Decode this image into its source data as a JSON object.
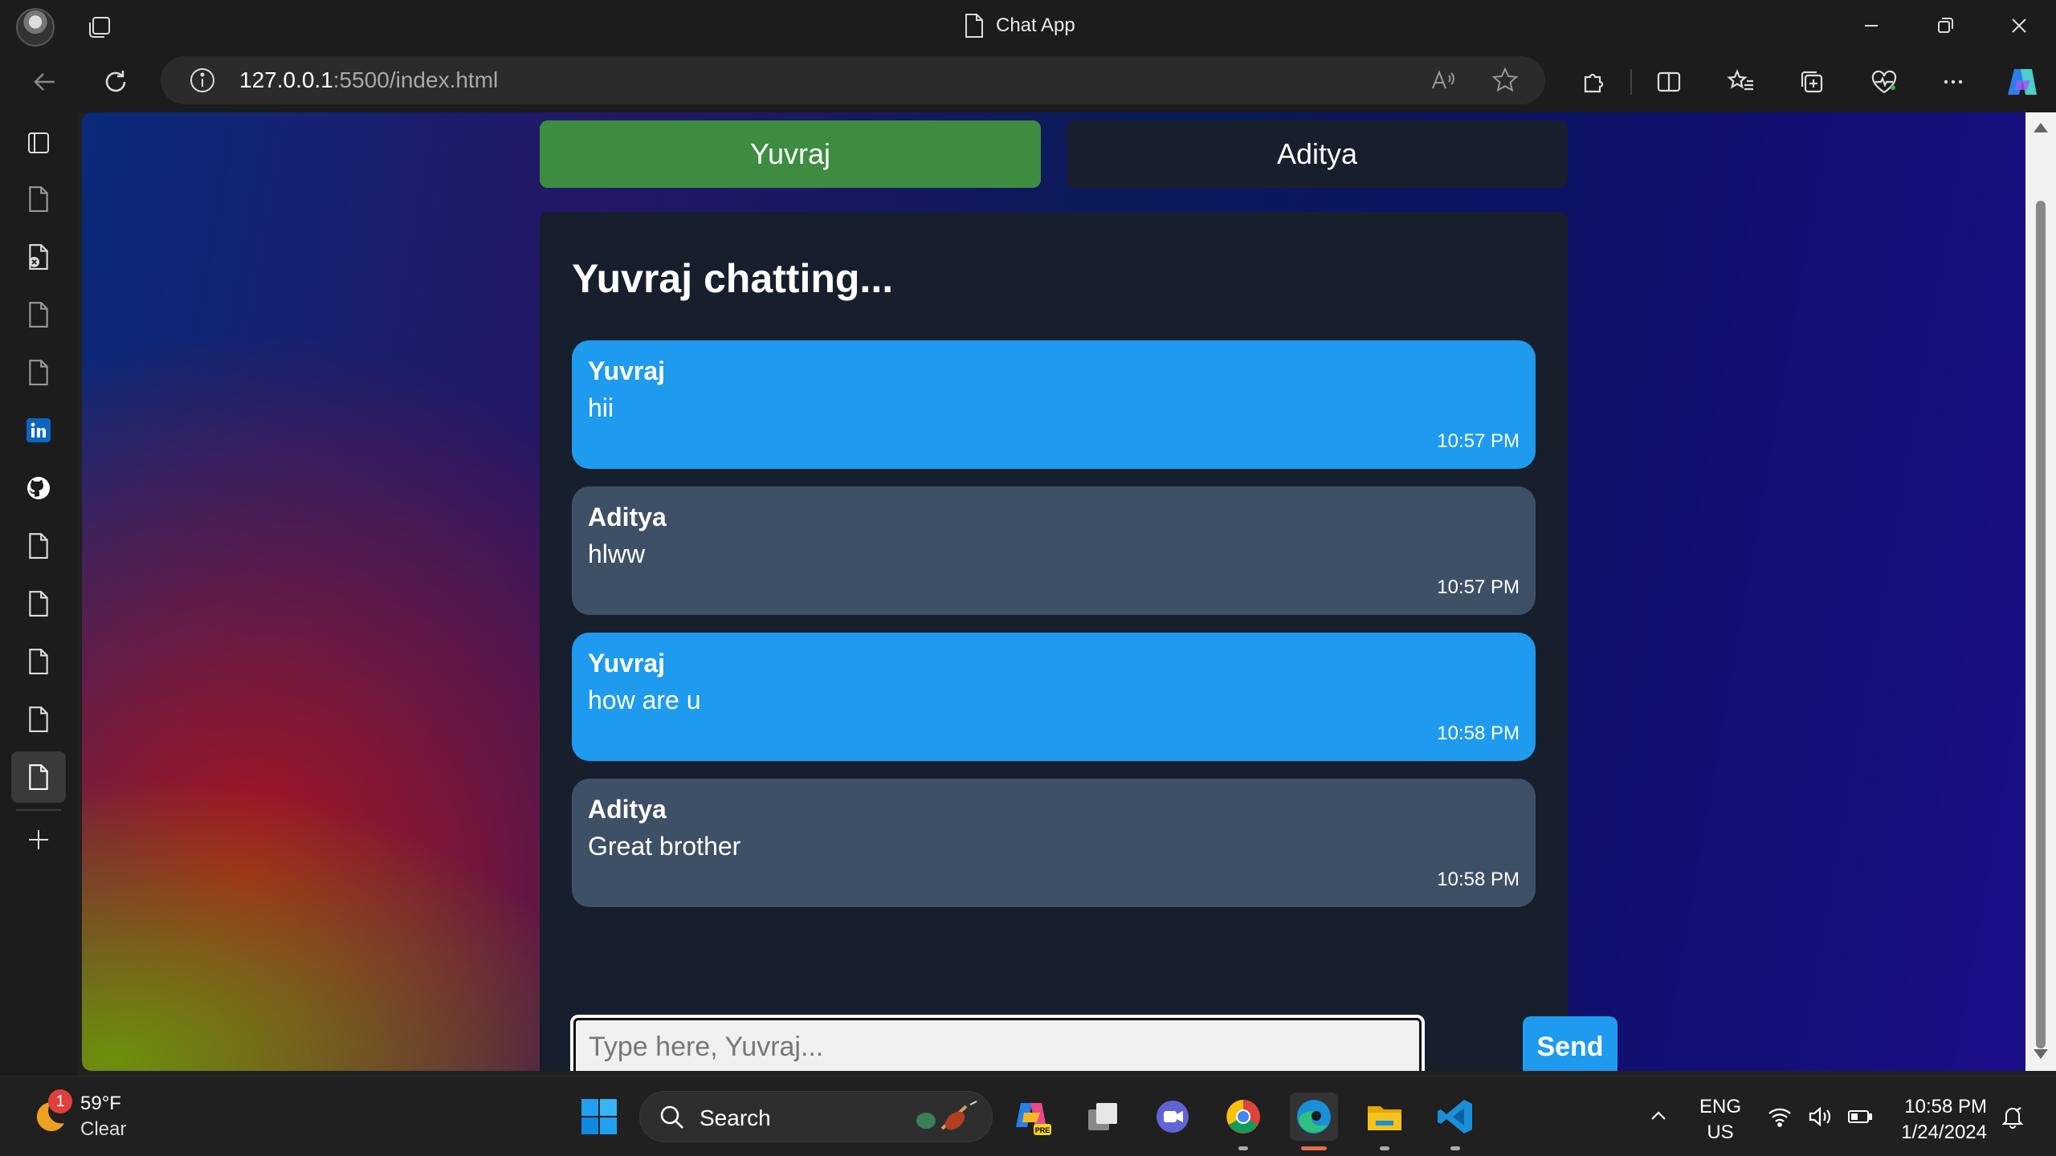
{
  "browser": {
    "tab_title": "Chat App",
    "url_host": "127.0.0.1",
    "url_rest": ":5500/index.html"
  },
  "app": {
    "tabs": [
      {
        "label": "Yuvraj",
        "color": "#3d8c40"
      },
      {
        "label": "Aditya",
        "color": "#171f2c"
      }
    ],
    "heading": "Yuvraj chatting...",
    "messages": [
      {
        "sender": "Yuvraj",
        "text": "hii",
        "time": "10:57 PM",
        "color": "#1e9bee"
      },
      {
        "sender": "Aditya",
        "text": "hlww",
        "time": "10:57 PM",
        "color": "#3e5066"
      },
      {
        "sender": "Yuvraj",
        "text": "how are u",
        "time": "10:58 PM",
        "color": "#1e9bee"
      },
      {
        "sender": "Aditya",
        "text": "Great brother",
        "time": "10:58 PM",
        "color": "#3e5066"
      }
    ],
    "input_placeholder": "Type here, Yuvraj...",
    "send_label": "Send"
  },
  "sidebar_icons": [
    "sidebar-icon",
    "document-icon",
    "document-close-icon",
    "document-icon",
    "document-icon",
    "linkedin-icon",
    "github-icon",
    "document-icon",
    "document-icon",
    "document-icon",
    "document-icon",
    "document-icon",
    "plus-icon"
  ],
  "taskbar": {
    "weather_badge": "1",
    "weather_temp": "59°F",
    "weather_cond": "Clear",
    "search_label": "Search",
    "lang_line1": "ENG",
    "lang_line2": "US",
    "time": "10:58 PM",
    "date": "1/24/2024"
  }
}
